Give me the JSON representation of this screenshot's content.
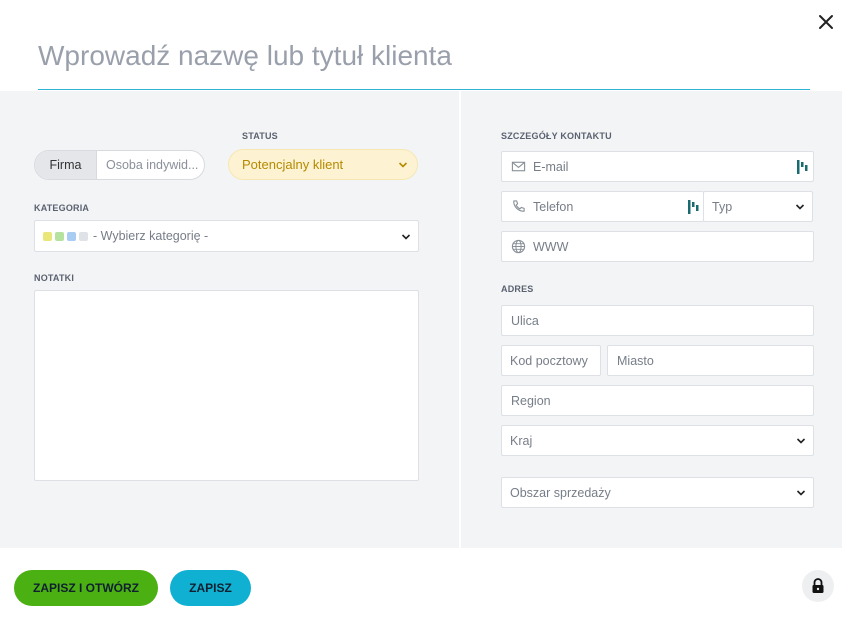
{
  "header": {
    "title_placeholder": "Wprowadź nazwę lub tytuł klienta",
    "close_icon": "close-icon",
    "accent": "#2fb3d6"
  },
  "left": {
    "type_toggle": {
      "active": "Firma",
      "inactive": "Osoba indywid..."
    },
    "status": {
      "label": "STATUS",
      "value": "Potencjalny klient",
      "color": "#b58a00",
      "bg": "#fdf3d3"
    },
    "category": {
      "label": "KATEGORIA",
      "placeholder": "- Wybierz kategorię -",
      "dot_colors": [
        "#e9e67a",
        "#b6e2a0",
        "#a9ccf2",
        "#dfe2e6"
      ]
    },
    "notes": {
      "label": "NOTATKI",
      "value": ""
    }
  },
  "right": {
    "contact": {
      "label": "SZCZEGÓŁY KONTAKTU",
      "email_placeholder": "E-mail",
      "phone_placeholder": "Telefon",
      "phone_type_placeholder": "Typ",
      "www_placeholder": "WWW"
    },
    "address": {
      "label": "ADRES",
      "street_placeholder": "Ulica",
      "postal_placeholder": "Kod pocztowy",
      "city_placeholder": "Miasto",
      "region_placeholder": "Region",
      "country_placeholder": "Kraj",
      "sales_area_placeholder": "Obszar sprzedaży"
    }
  },
  "footer": {
    "save_open_label": "ZAPISZ I OTWÓRZ",
    "save_label": "ZAPISZ",
    "save_open_color": "#4bb011",
    "save_color": "#10b0d2",
    "lock_icon": "lock-icon"
  }
}
